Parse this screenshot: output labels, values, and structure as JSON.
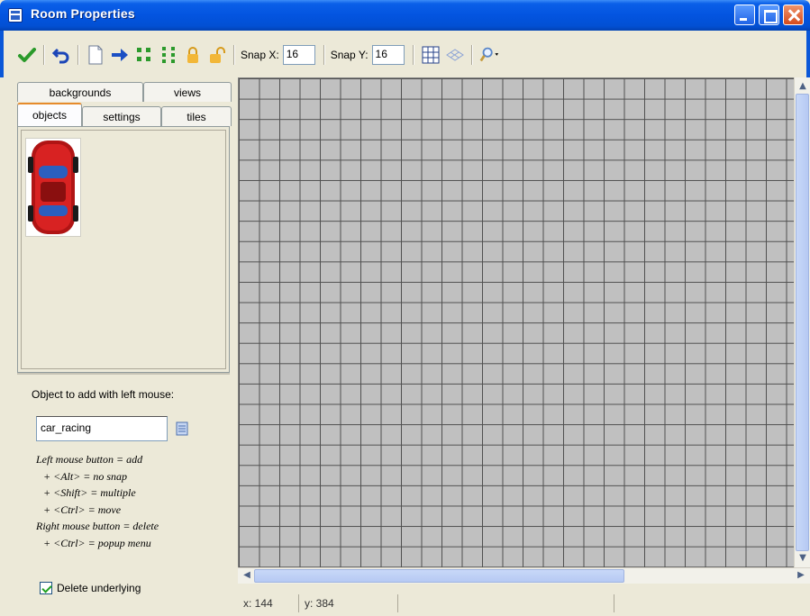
{
  "window": {
    "title": "Room Properties"
  },
  "toolbar": {
    "snap_x_label": "Snap X:",
    "snap_x_value": "16",
    "snap_y_label": "Snap Y:",
    "snap_y_value": "16",
    "icons": [
      "ok-check-icon",
      "undo-icon",
      "clear-icon",
      "shift-arrow-icon",
      "sort-x-icon",
      "sort-y-icon",
      "lock-instances-icon",
      "unlock-instances-icon",
      "grid-icon",
      "isometric-grid-icon",
      "zoom-icon"
    ]
  },
  "tabs": {
    "back": [
      "backgrounds",
      "views"
    ],
    "front": [
      "objects",
      "settings",
      "tiles"
    ],
    "active": "objects"
  },
  "objects_panel": {
    "add_label": "Object to add with left mouse:",
    "object_name": "car_racing",
    "help_lines": [
      "Left mouse button = add",
      "+ <Alt> = no snap",
      "+ <Shift> = multiple",
      "+ <Ctrl> = move",
      "Right mouse button = delete",
      "+ <Ctrl> = popup menu"
    ],
    "delete_underlying_label": "Delete underlying",
    "delete_underlying_checked": true
  },
  "status": {
    "x": "x: 144",
    "y": "y: 384"
  }
}
